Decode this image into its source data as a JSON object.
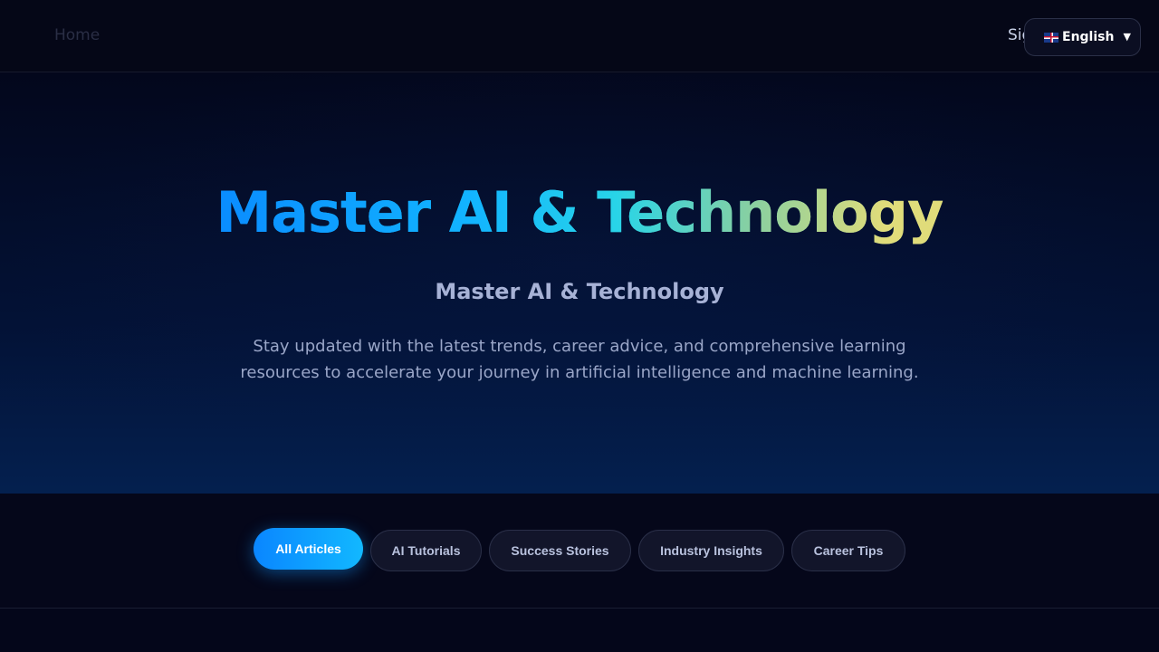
{
  "nav": {
    "home_label": "Home",
    "signin_label": "Sign In",
    "language": {
      "selected": "English",
      "flag_icon": "uk-flag-icon"
    }
  },
  "hero": {
    "title": "Master AI & Technology",
    "subtitle": "Master AI & Technology",
    "description": "Stay updated with the latest trends, career advice, and comprehensive learning resources to accelerate your journey in artificial intelligence and machine learning."
  },
  "filters": [
    {
      "label": "All Articles",
      "active": true
    },
    {
      "label": "AI Tutorials",
      "active": false
    },
    {
      "label": "Success Stories",
      "active": false
    },
    {
      "label": "Industry Insights",
      "active": false
    },
    {
      "label": "Career Tips",
      "active": false
    }
  ],
  "colors": {
    "accent": "#0a86ff",
    "background": "#05071a",
    "title_gradient": [
      "#0a8cff",
      "#28d4e8",
      "#e0dc7a"
    ]
  }
}
